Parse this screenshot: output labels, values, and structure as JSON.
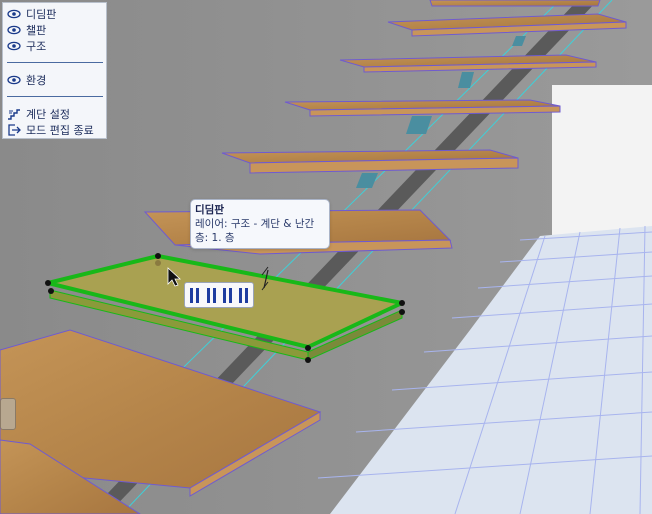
{
  "panel": {
    "items": [
      {
        "label": "디딤판",
        "icon": "eye-icon"
      },
      {
        "label": "챌판",
        "icon": "eye-icon"
      },
      {
        "label": "구조",
        "icon": "eye-icon"
      },
      {
        "label": "환경",
        "icon": "eye-icon"
      },
      {
        "label": "계단 설정",
        "icon": "stair-settings-icon"
      },
      {
        "label": "모드 편집 종료",
        "icon": "exit-icon"
      }
    ]
  },
  "tooltip": {
    "title": "디딤판",
    "layer": "레이어: 구조 - 계단 & 난간",
    "story": "층: 1. 층"
  },
  "colors": {
    "wall": "#8f8f8f",
    "floor": "#dbe3ef",
    "grid": "#9aa8e6",
    "tread": "#b98a4e",
    "tread_edge": "#6f5bd0",
    "stringer": "#5a5a5a",
    "selection": "#18b818",
    "icon": "#1a3a8a"
  }
}
